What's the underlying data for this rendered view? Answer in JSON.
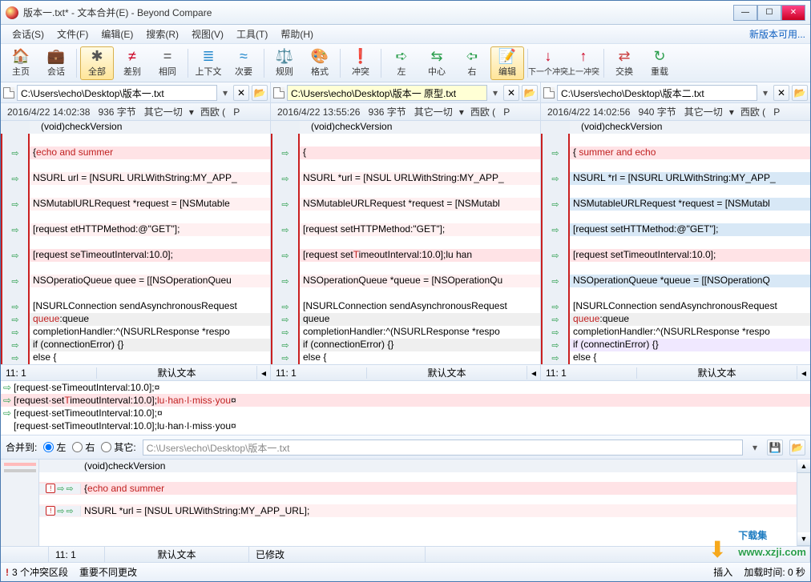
{
  "window": {
    "title": "版本一.txt* - 文本合并(E) - Beyond Compare"
  },
  "menu": {
    "items": [
      "会话(S)",
      "文件(F)",
      "编辑(E)",
      "搜索(R)",
      "视图(V)",
      "工具(T)",
      "帮助(H)"
    ],
    "new_version": "新版本可用..."
  },
  "toolbar": {
    "home": "主页",
    "session": "会话",
    "all": "全部",
    "diff": "差别",
    "same": "相同",
    "context": "上下文",
    "minor": "次要",
    "rules": "规则",
    "format": "格式",
    "conflict": "冲突",
    "left": "左",
    "center": "中心",
    "right": "右",
    "edit": "编辑",
    "next_conf": "下一个冲突",
    "prev_conf": "上一冲突",
    "swap": "交换",
    "reload": "重载"
  },
  "files": {
    "left": "C:\\Users\\echo\\Desktop\\版本一.txt",
    "center": "C:\\Users\\echo\\Desktop\\版本一 原型.txt",
    "right": "C:\\Users\\echo\\Desktop\\版本二.txt"
  },
  "info": {
    "left": {
      "ts": "2016/4/22 14:02:38",
      "size": "936 字节",
      "rest": "其它一切",
      "enc": "西欧 (",
      "p": "P"
    },
    "center": {
      "ts": "2016/4/22 13:55:26",
      "size": "936 字节",
      "rest": "其它一切",
      "enc": "西欧 (",
      "p": "P"
    },
    "right": {
      "ts": "2016/4/22 14:02:56",
      "size": "940 字节",
      "rest": "其它一切",
      "enc": "西欧 (",
      "p": "P"
    }
  },
  "code": {
    "head": "   (void)checkVersion",
    "left": [
      {
        "t": "{echo and summer",
        "bg": "pink",
        "red": "echo and summer"
      },
      {
        "t": "",
        "bg": ""
      },
      {
        "t": "NSURL url = [NSURL URLWithString:MY_APP_",
        "bg": "pinklt"
      },
      {
        "t": "",
        "bg": ""
      },
      {
        "t": "NSMutablURLRequest *request = [NSMutable",
        "bg": "pinklt"
      },
      {
        "t": "",
        "bg": ""
      },
      {
        "t": "[request etHTTPMethod:@\"GET\"];",
        "bg": "pinklt"
      },
      {
        "t": "",
        "bg": ""
      },
      {
        "t": "[request seTimeoutInterval:10.0];",
        "bg": "pink"
      },
      {
        "t": "",
        "bg": ""
      },
      {
        "t": "NSOperatioQueue quee = [[NSOperationQueu",
        "bg": "pinklt"
      },
      {
        "t": "",
        "bg": ""
      },
      {
        "t": "[NSURLConnection sendAsynchronousRequest",
        "bg": ""
      },
      {
        "t": "queue:queue",
        "bg": "gray",
        "red": "queue"
      },
      {
        "t": "completionHandler:^(NSURLResponse *respo",
        "bg": ""
      },
      {
        "t": "if (connectionError) {}",
        "bg": "gray"
      },
      {
        "t": "else {",
        "bg": ""
      }
    ],
    "center": [
      {
        "t": "{",
        "bg": "pink"
      },
      {
        "t": "",
        "bg": ""
      },
      {
        "t": "NSURL *url = [NSUL URLWithString:MY_APP_",
        "bg": "pinklt"
      },
      {
        "t": "",
        "bg": ""
      },
      {
        "t": "NSMutableURLRequest *request = [NSMutabl",
        "bg": "pinklt"
      },
      {
        "t": "",
        "bg": ""
      },
      {
        "t": "[request setHTTPMethod:\"GET\"];",
        "bg": "pinklt"
      },
      {
        "t": "",
        "bg": ""
      },
      {
        "t": "[request setTimeoutInterval:10.0];lu han",
        "bg": "pink",
        "red": "T"
      },
      {
        "t": "",
        "bg": ""
      },
      {
        "t": "NSOperationQueue *queue = [NSOperationQu",
        "bg": "pinklt"
      },
      {
        "t": "",
        "bg": ""
      },
      {
        "t": "[NSURLConnection sendAsynchronousRequest",
        "bg": ""
      },
      {
        "t": "queue",
        "bg": "gray"
      },
      {
        "t": "completionHandler:^(NSURLResponse *respo",
        "bg": ""
      },
      {
        "t": "if (connectionError) {}",
        "bg": "gray"
      },
      {
        "t": "else {",
        "bg": ""
      }
    ],
    "right": [
      {
        "t": "{ summer and echo",
        "bg": "pink",
        "red": " summer and echo"
      },
      {
        "t": "",
        "bg": ""
      },
      {
        "t": "NSURL *rl = [NSURL URLWithString:MY_APP_",
        "bg": "blue"
      },
      {
        "t": "",
        "bg": ""
      },
      {
        "t": "NSMutableURLRequest *request = [NSMutabl",
        "bg": "blue"
      },
      {
        "t": "",
        "bg": ""
      },
      {
        "t": "[request setHTTMethod:@\"GET\"];",
        "bg": "blue"
      },
      {
        "t": "",
        "bg": ""
      },
      {
        "t": "[request setTimeoutInterval:10.0];",
        "bg": "pink"
      },
      {
        "t": "",
        "bg": ""
      },
      {
        "t": "NSOperationQueue *queue = [[NSOperationQ",
        "bg": "blue"
      },
      {
        "t": "",
        "bg": ""
      },
      {
        "t": "[NSURLConnection sendAsynchronousRequest",
        "bg": ""
      },
      {
        "t": "queue:queue",
        "bg": "gray",
        "red": "queue"
      },
      {
        "t": "completionHandler:^(NSURLResponse *respo",
        "bg": ""
      },
      {
        "t": "if (connectinError) {}",
        "bg": "purple"
      },
      {
        "t": "else {",
        "bg": ""
      }
    ]
  },
  "panestatus": {
    "pos": "11: 1",
    "enc": "默认文本"
  },
  "diffrows": [
    "[request·seTimeoutInterval:10.0];¤",
    "[request·setTimeoutInterval:10.0];lu·han·l·miss·you¤",
    "[request·setTimeoutInterval:10.0];¤",
    "[request·setTimeoutInterval:10.0];lu·han·l·miss·you¤"
  ],
  "merge": {
    "label": "合并到:",
    "left": "左",
    "right": "右",
    "other": "其它:",
    "path": "C:\\Users\\echo\\Desktop\\版本一.txt"
  },
  "result": {
    "head": "(void)checkVersion",
    "l1": "{echo and summer",
    "l2": "NSURL *url = [NSUL URLWithString:MY_APP_URL];"
  },
  "rstatus": {
    "pos": "11: 1",
    "enc": "默认文本",
    "mod": "已修改"
  },
  "status": {
    "conflicts": "3 个冲突区段",
    "important": "重要不同更改",
    "ins": "插入",
    "load": "加载时间: 0 秒"
  },
  "watermark": {
    "site": "www.xzji.com",
    "brand": "下载集"
  }
}
